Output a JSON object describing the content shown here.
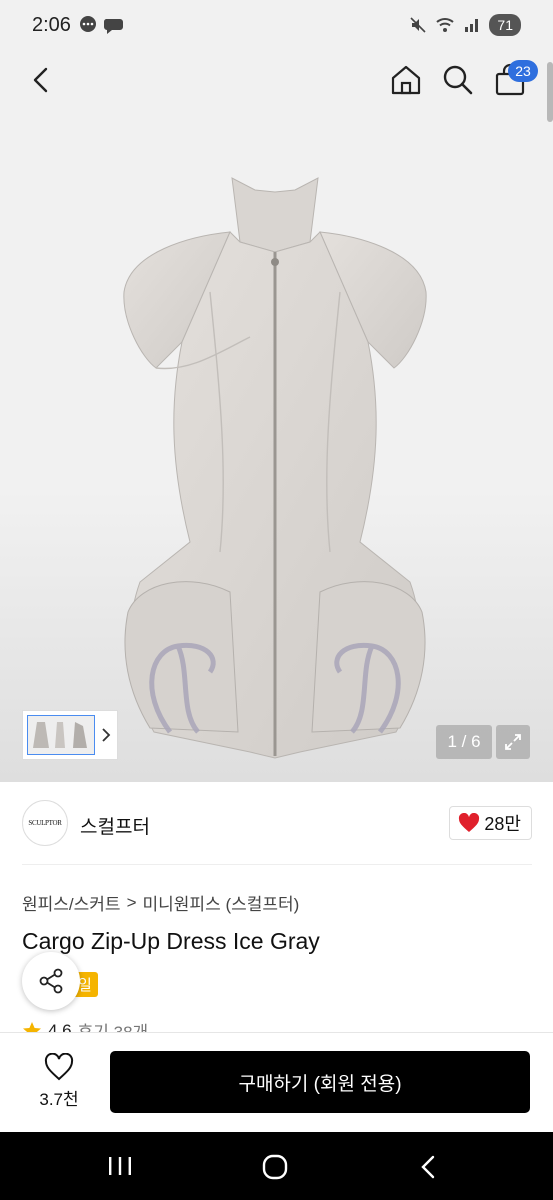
{
  "status_bar": {
    "time": "2:06",
    "battery": "71"
  },
  "top_nav": {
    "cart_count": "23"
  },
  "gallery": {
    "page_counter": "1 / 6"
  },
  "brand": {
    "logo_text": "SCULPTOR",
    "name": "스컬프터",
    "likes": "28만"
  },
  "breadcrumb": {
    "level1": "원피스/스커트",
    "separator": ">",
    "level2": "미니원피스 (스컬프터)"
  },
  "product": {
    "title": "Cargo Zip-Up Dress Ice Gray",
    "badge": "일",
    "rating": "4.6",
    "reviews": "후기 38개"
  },
  "bottom_bar": {
    "wish_count": "3.7천",
    "buy_label": "구매하기 (회원 전용)"
  },
  "colors": {
    "accent_blue": "#2f6fde",
    "heart_red": "#e0202c",
    "badge_yellow": "#f5b400",
    "button_black": "#000000"
  }
}
